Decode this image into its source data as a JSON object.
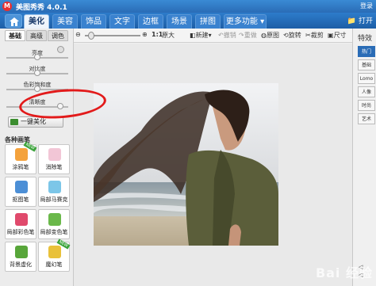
{
  "app": {
    "title": "美图秀秀 4.0.1",
    "login": "登录",
    "open": "打开"
  },
  "nav": {
    "tabs": [
      "美化",
      "美容",
      "饰品",
      "文字",
      "边框",
      "场景",
      "拼图",
      "更多功能"
    ],
    "active": "美化"
  },
  "toolbar": {
    "actual_size": "原大",
    "new_doc": "新建",
    "undo": "撤销",
    "redo": "重做",
    "original": "原图",
    "rotate": "旋转",
    "crop": "裁剪",
    "resize": "尺寸",
    "ratio": "1:1"
  },
  "left_panel": {
    "subtabs": [
      "基础",
      "高级",
      "调色"
    ],
    "adjustments": [
      {
        "label": "亮度",
        "level": 0.5
      },
      {
        "label": "对比度",
        "level": 0.5
      },
      {
        "label": "色彩饱和度",
        "level": 0.5
      },
      {
        "label": "清晰度",
        "level": 0.85
      }
    ],
    "one_key": "一键美化",
    "section_title": "各种画笔",
    "brushes": [
      {
        "label": "涂鸦笔",
        "icon": "doodle-pen-icon",
        "badge": "NEW"
      },
      {
        "label": "消除笔",
        "icon": "eraser-icon",
        "badge": ""
      },
      {
        "label": "抠图笔",
        "icon": "cutout-icon",
        "badge": ""
      },
      {
        "label": "局部马赛克",
        "icon": "mosaic-icon",
        "badge": ""
      },
      {
        "label": "局部彩色笔",
        "icon": "color-pen-icon",
        "badge": ""
      },
      {
        "label": "局部变色笔",
        "icon": "recolor-pen-icon",
        "badge": ""
      },
      {
        "label": "背景虚化",
        "icon": "blur-icon",
        "badge": ""
      },
      {
        "label": "魔幻笔",
        "icon": "magic-pen-icon",
        "badge": "NEW"
      }
    ]
  },
  "right_panel": {
    "title": "特效",
    "tabs": [
      "热门",
      "基础",
      "Lomo",
      "人像",
      "时尚",
      "艺术"
    ],
    "active": "热门",
    "footer": [
      "◁",
      "◁"
    ]
  },
  "watermark": "Bai 经验",
  "colors": {
    "brand_blue": "#2a6cb6",
    "annotation_red": "#e21a1a"
  }
}
